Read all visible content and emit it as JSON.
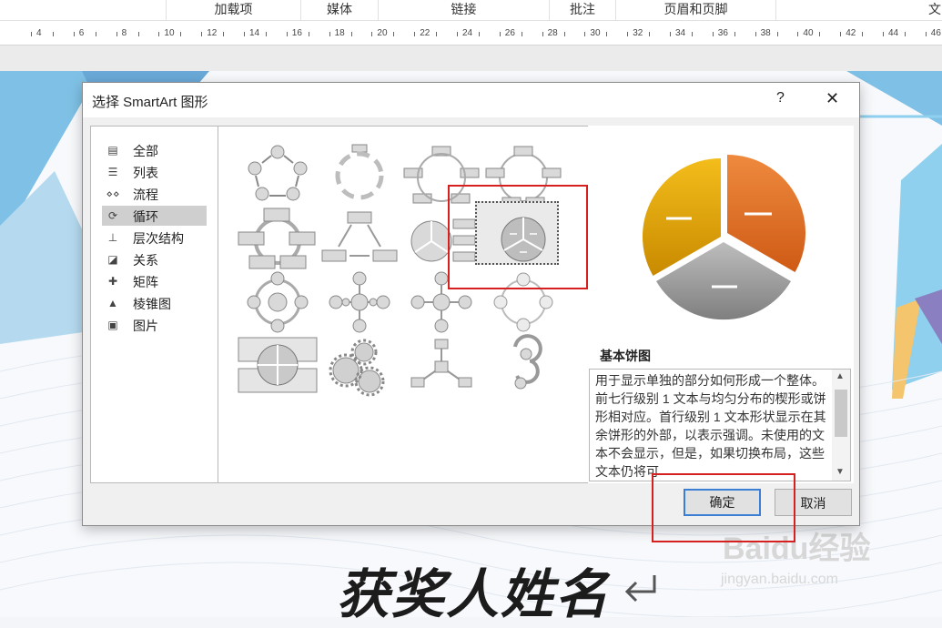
{
  "ribbon": {
    "groups": [
      "加载项",
      "媒体",
      "链接",
      "批注",
      "页眉和页脚",
      "文"
    ]
  },
  "ruler": {
    "numbers": [
      "4",
      "6",
      "8",
      "10",
      "12",
      "14",
      "16",
      "18",
      "20",
      "22",
      "24",
      "26",
      "28",
      "30",
      "32",
      "34",
      "36",
      "38",
      "40",
      "42",
      "44",
      "46"
    ]
  },
  "background": {
    "heading": "获奖人姓名",
    "watermark": "Baidu经验",
    "watermark_sub": "jingyan.baidu.com"
  },
  "dialog": {
    "title": "选择 SmartArt 图形",
    "help": "?",
    "close": "✕",
    "categories": [
      {
        "label": "全部",
        "icon": "all-icon"
      },
      {
        "label": "列表",
        "icon": "list-icon"
      },
      {
        "label": "流程",
        "icon": "process-icon"
      },
      {
        "label": "循环",
        "icon": "cycle-icon",
        "selected": true
      },
      {
        "label": "层次结构",
        "icon": "hierarchy-icon"
      },
      {
        "label": "关系",
        "icon": "relationship-icon"
      },
      {
        "label": "矩阵",
        "icon": "matrix-icon"
      },
      {
        "label": "棱锥图",
        "icon": "pyramid-icon"
      },
      {
        "label": "图片",
        "icon": "picture-icon"
      }
    ],
    "selected_layout": "基本饼图",
    "description": "用于显示单独的部分如何形成一个整体。前七行级别 1 文本与均匀分布的楔形或饼形相对应。首行级别 1 文本形状显示在其余饼形的外部，以表示强调。未使用的文本不会显示，但是，如果切换布局，这些文本仍将可",
    "ok_label": "确定",
    "cancel_label": "取消"
  },
  "colors": {
    "accent": "#3b7fd4",
    "highlight": "#d62020",
    "pie_orange": "#e8762c",
    "pie_yellow": "#e6a20f",
    "pie_gray": "#9a9a9a"
  }
}
